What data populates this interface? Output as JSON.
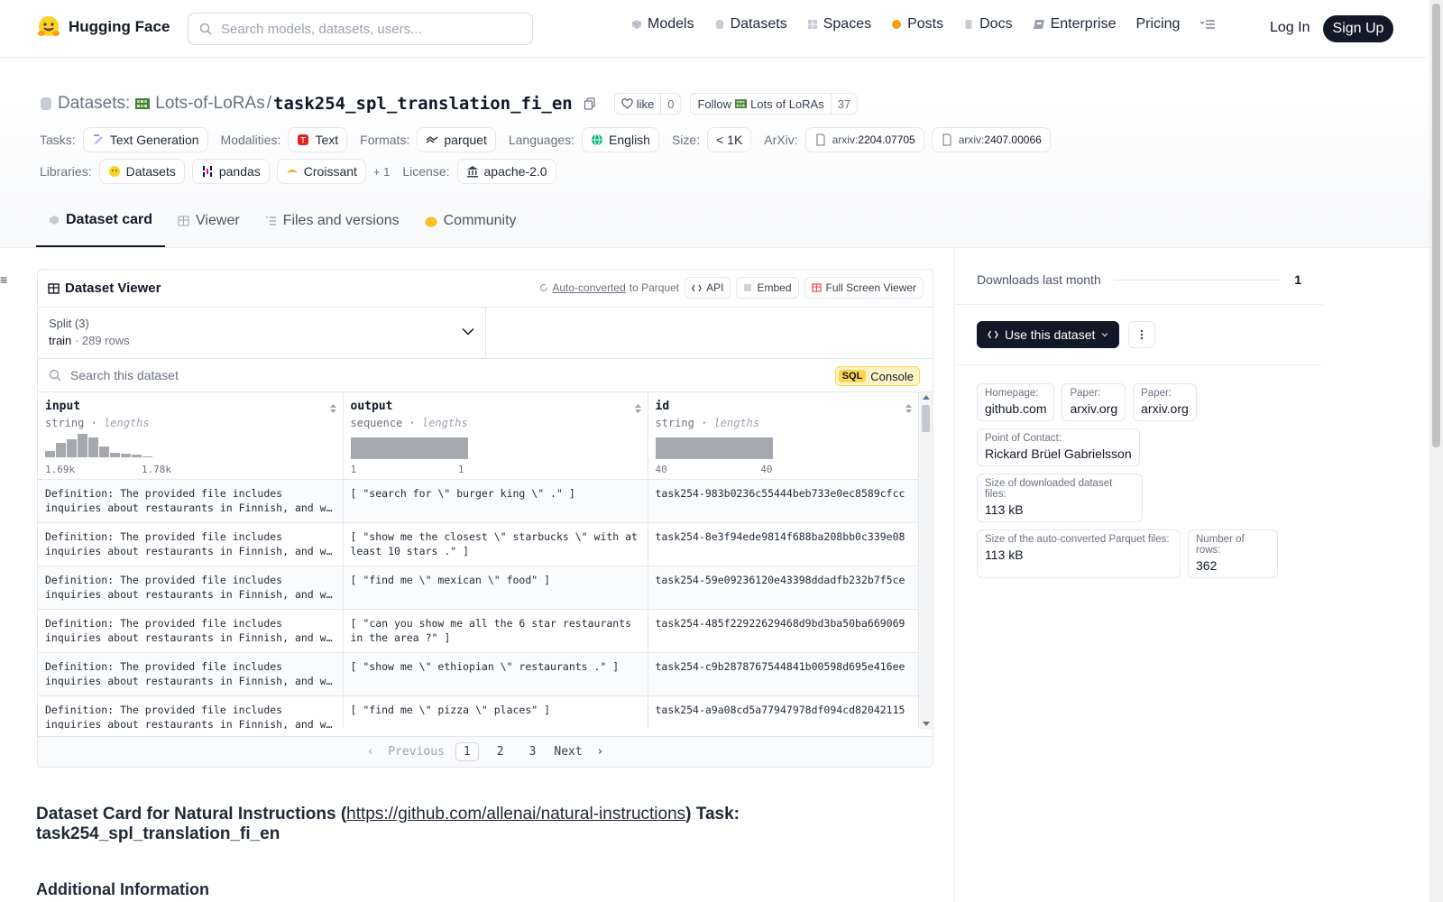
{
  "header": {
    "brand": "Hugging Face",
    "search_placeholder": "Search models, datasets, users...",
    "nav": [
      {
        "label": "Models",
        "icon": "cube-icon"
      },
      {
        "label": "Datasets",
        "icon": "database-icon"
      },
      {
        "label": "Spaces",
        "icon": "grid-icon"
      },
      {
        "label": "Posts",
        "icon": "chat-bubble-icon"
      },
      {
        "label": "Docs",
        "icon": "doc-icon"
      },
      {
        "label": "Enterprise",
        "icon": "enterprise-icon"
      },
      {
        "label": "Pricing",
        "icon": ""
      }
    ],
    "login": "Log In",
    "signup": "Sign Up"
  },
  "repo": {
    "section": "Datasets:",
    "owner": "Lots-of-LoRAs",
    "separator": "/",
    "name": "task254_spl_translation_fi_en",
    "like_label": "like",
    "like_count": "0",
    "follow_label": "Follow",
    "follow_org": "Lots of LoRAs",
    "follow_count": "37"
  },
  "meta": {
    "tasks_label": "Tasks:",
    "task": "Text Generation",
    "modalities_label": "Modalities:",
    "modality": "Text",
    "formats_label": "Formats:",
    "format": "parquet",
    "languages_label": "Languages:",
    "language": "English",
    "size_label": "Size:",
    "size": "< 1K",
    "arxiv_label": "ArXiv:",
    "arxiv1_prefix": "arxiv:",
    "arxiv1": "2204.07705",
    "arxiv2_prefix": "arxiv:",
    "arxiv2": "2407.00066",
    "libraries_label": "Libraries:",
    "lib1": "Datasets",
    "lib2": "pandas",
    "lib3": "Croissant",
    "lib_more": "+ 1",
    "license_label": "License:",
    "license": "apache-2.0"
  },
  "tabs": [
    {
      "label": "Dataset card",
      "active": true
    },
    {
      "label": "Viewer",
      "active": false
    },
    {
      "label": "Files and versions",
      "active": false
    },
    {
      "label": "Community",
      "active": false
    }
  ],
  "viewer": {
    "title": "Dataset Viewer",
    "autoconv_link": "Auto-converted",
    "autoconv_rest": "to Parquet",
    "api": "API",
    "embed": "Embed",
    "fullscreen": "Full Screen Viewer",
    "split_label": "Split (3)",
    "split_value": "train",
    "split_rows": "289 rows",
    "search_placeholder": "Search this dataset",
    "sql_badge": "SQL",
    "sql_label": "Console",
    "columns": [
      {
        "name": "input",
        "type": "string",
        "stat": "lengths",
        "min": "1.69k",
        "max": "1.78k"
      },
      {
        "name": "output",
        "type": "sequence",
        "stat": "lengths",
        "min": "1",
        "max": "1"
      },
      {
        "name": "id",
        "type": "string",
        "stat": "lengths",
        "min": "40",
        "max": "40"
      }
    ],
    "input_histogram": [
      0.25,
      0.6,
      0.75,
      1.0,
      0.85,
      0.45,
      0.2,
      0.15,
      0.1,
      0.05
    ],
    "rows": [
      {
        "input": "Definition: The provided file includes inquiries about restaurants in Finnish, and we need to translate them to English.",
        "output": "[ \"search for \\\" burger king \\\" .\" ]",
        "id": "task254-983b0236c55444beb733e0ec8589cfcc"
      },
      {
        "input": "Definition: The provided file includes inquiries about restaurants in Finnish, and we need to translate them to English.",
        "output": "[ \"show me the closest \\\" starbucks \\\" with at least 10 stars .\" ]",
        "id": "task254-8e3f94ede9814f688ba208bb0c339e08"
      },
      {
        "input": "Definition: The provided file includes inquiries about restaurants in Finnish, and we need to translate them to English.",
        "output": "[ \"find me \\\" mexican \\\" food\" ]",
        "id": "task254-59e09236120e43398ddadfb232b7f5ce"
      },
      {
        "input": "Definition: The provided file includes inquiries about restaurants in Finnish, and we need to translate them to English.",
        "output": "[ \"can you show me all the 6 star restaurants in the area ?\" ]",
        "id": "task254-485f22922629468d9bd3ba50ba669069"
      },
      {
        "input": "Definition: The provided file includes inquiries about restaurants in Finnish, and we need to translate them to English.",
        "output": "[ \"show me \\\" ethiopian \\\" restaurants .\" ]",
        "id": "task254-c9b2878767544841b00598d695e416ee"
      },
      {
        "input": "Definition: The provided file includes inquiries about restaurants in Finnish, and we need to translate them to English.",
        "output": "[ \"find me \\\" pizza \\\" places\" ]",
        "id": "task254-a9a08cd5a77947978df094cd82042115"
      }
    ],
    "pager": {
      "prev": "Previous",
      "pages": [
        "1",
        "2",
        "3"
      ],
      "current": "1",
      "next": "Next"
    }
  },
  "card": {
    "title_pre": "Dataset Card for Natural Instructions (",
    "title_link": "https://github.com/allenai/natural-instructions",
    "title_post": ") Task: task254_spl_translation_fi_en",
    "subheading": "Additional Information"
  },
  "sidebar": {
    "downloads_label": "Downloads last month",
    "downloads_value": "1",
    "use_button": "Use this dataset",
    "info": [
      {
        "k": "Homepage:",
        "v": "github.com"
      },
      {
        "k": "Paper:",
        "v": "arxiv.org"
      },
      {
        "k": "Paper:",
        "v": "arxiv.org"
      },
      {
        "k": "Point of Contact:",
        "v": "Rickard Brüel Gabrielsson"
      },
      {
        "k": "Size of downloaded dataset files:",
        "v": "113 kB"
      },
      {
        "k": "Size of the auto-converted Parquet files:",
        "v": "113 kB"
      },
      {
        "k": "Number of rows:",
        "v": "362"
      }
    ]
  }
}
